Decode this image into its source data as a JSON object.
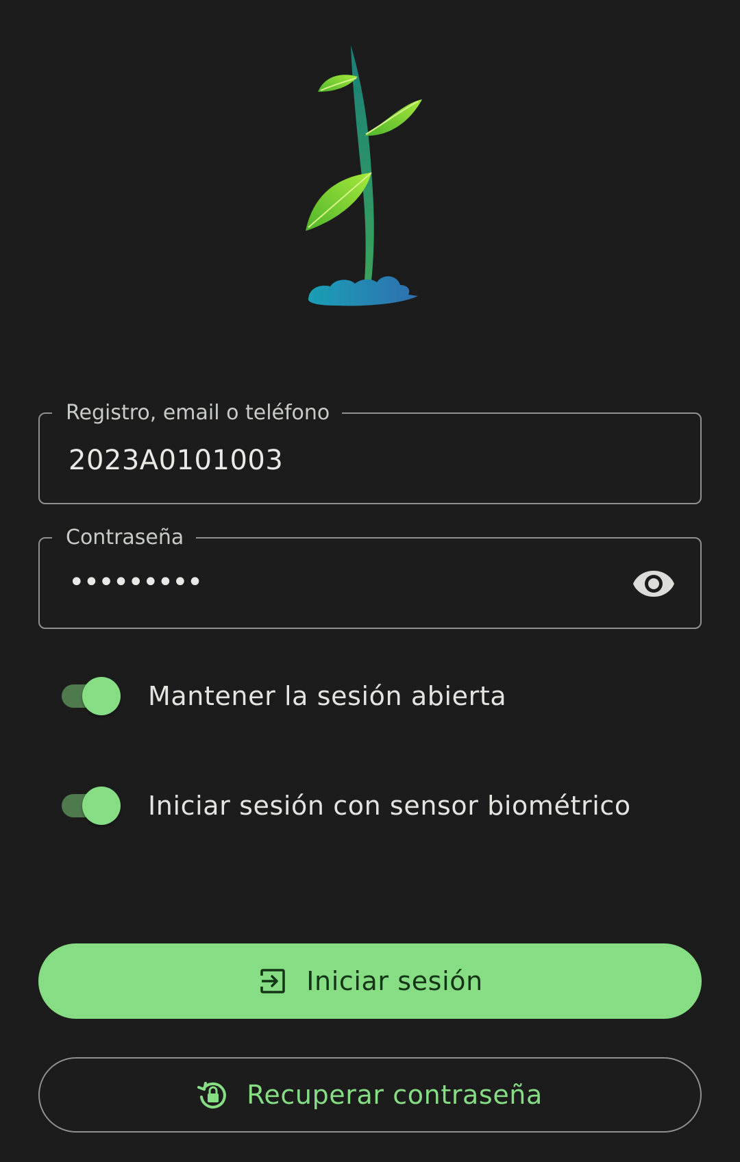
{
  "colors": {
    "background": "#1b1c1b",
    "accent": "#86dd84",
    "accent_dark_text": "#143515",
    "switch_track": "#4f7a4e",
    "outline": "#8f918f"
  },
  "logo": {
    "icon": "seedling-icon"
  },
  "login_form": {
    "username_field": {
      "label": "Registro, email o teléfono",
      "value": "2023A0101003"
    },
    "password_field": {
      "label": "Contraseña",
      "masked_value": "•••••••••",
      "toggle_icon": "eye-icon"
    },
    "keep_session": {
      "label": "Mantener la sesión abierta",
      "checked": true
    },
    "biometric": {
      "label": "Iniciar sesión con sensor biométrico",
      "checked": true
    }
  },
  "actions": {
    "login": {
      "label": "Iniciar sesión",
      "icon": "login-icon"
    },
    "recover": {
      "label": "Recuperar contraseña",
      "icon": "lock-reset-icon"
    }
  }
}
